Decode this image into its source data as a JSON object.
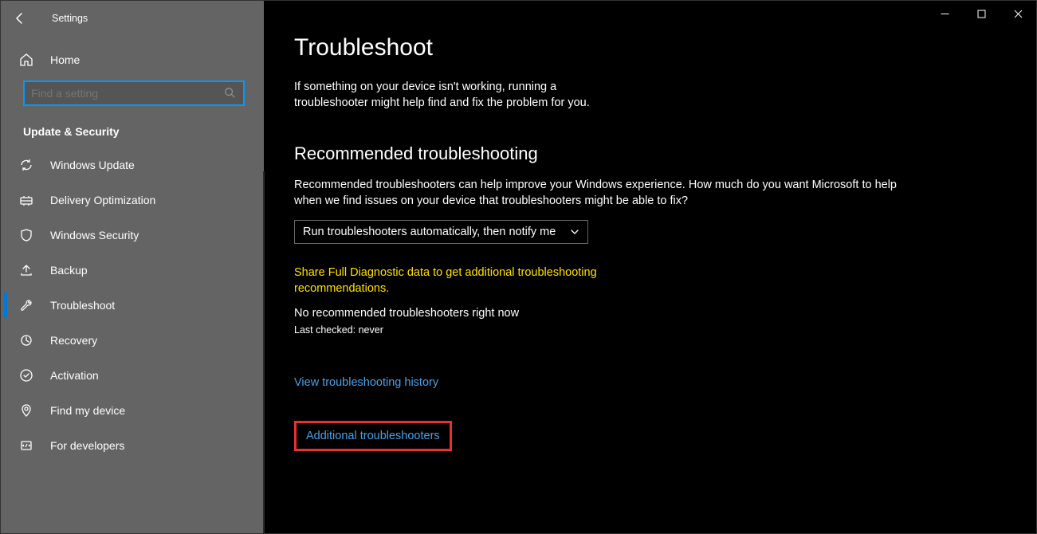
{
  "app": {
    "title": "Settings"
  },
  "window_controls": {
    "minimize": "Minimize",
    "maximize": "Maximize",
    "close": "Close"
  },
  "sidebar": {
    "home": "Home",
    "search_placeholder": "Find a setting",
    "section": "Update & Security",
    "items": [
      {
        "label": "Windows Update",
        "icon": "refresh"
      },
      {
        "label": "Delivery Optimization",
        "icon": "delivery"
      },
      {
        "label": "Windows Security",
        "icon": "shield"
      },
      {
        "label": "Backup",
        "icon": "backup"
      },
      {
        "label": "Troubleshoot",
        "icon": "wrench",
        "selected": true
      },
      {
        "label": "Recovery",
        "icon": "recovery"
      },
      {
        "label": "Activation",
        "icon": "activation"
      },
      {
        "label": "Find my device",
        "icon": "location"
      },
      {
        "label": "For developers",
        "icon": "developer"
      }
    ]
  },
  "main": {
    "title": "Troubleshoot",
    "intro": "If something on your device isn't working, running a troubleshooter might help find and fix the problem for you.",
    "recommended": {
      "heading": "Recommended troubleshooting",
      "body": "Recommended troubleshooters can help improve your Windows experience. How much do you want Microsoft to help when we find issues on your device that troubleshooters might be able to fix?",
      "dropdown_value": "Run troubleshooters automatically, then notify me",
      "diagnostic_link": "Share Full Diagnostic data to get additional troubleshooting recommendations.",
      "status": "No recommended troubleshooters right now",
      "last_checked": "Last checked: never"
    },
    "links": {
      "history": "View troubleshooting history",
      "additional": "Additional troubleshooters"
    }
  }
}
